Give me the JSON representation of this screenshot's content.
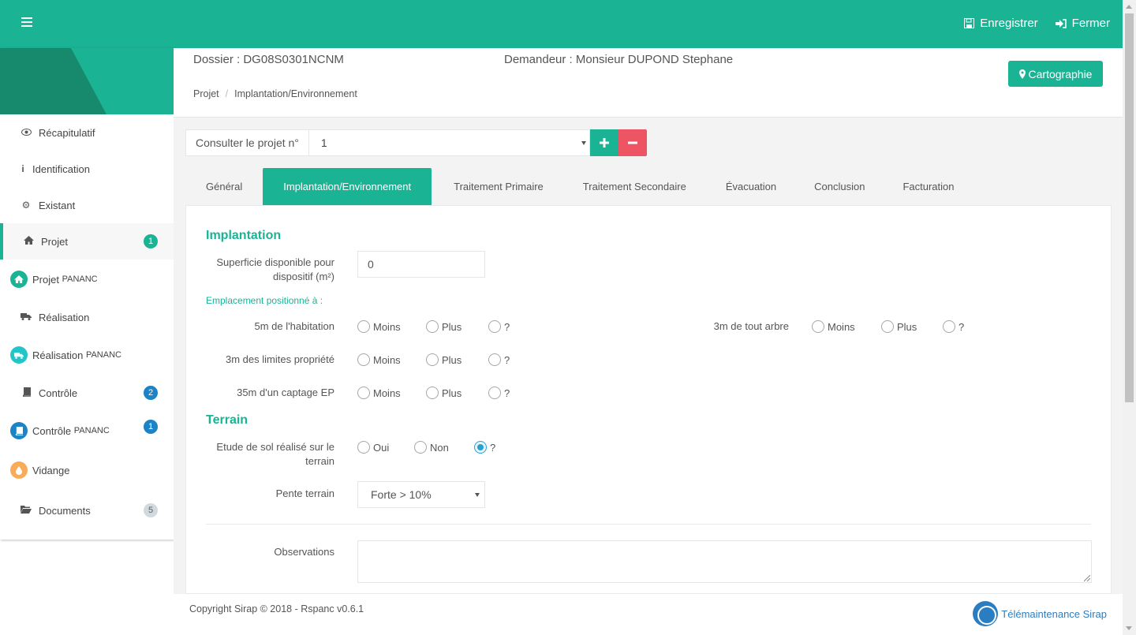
{
  "topbar": {
    "save_label": "Enregistrer",
    "close_label": "Fermer",
    "color": "#1ab394"
  },
  "sidebar": {
    "items": [
      {
        "label": "Récapitulatif",
        "icon": "eye-icon",
        "glyph": "👁"
      },
      {
        "label": "Identification",
        "icon": "info-icon",
        "glyph": "ℹ"
      },
      {
        "label": "Existant",
        "icon": "cogs-icon",
        "glyph": "⚙"
      },
      {
        "label": "Projet",
        "icon": "home-icon",
        "glyph": "⌂",
        "badge": "1",
        "active": true
      },
      {
        "label": "Projet",
        "label_small": "PANANC",
        "icon": "home-circle-icon"
      },
      {
        "label": "Réalisation",
        "icon": "truck-icon",
        "glyph": "🚚"
      },
      {
        "label": "Réalisation",
        "label_small": "PANANC",
        "icon": "truck-circle-icon"
      },
      {
        "label": "Contrôle",
        "icon": "book-icon",
        "glyph": "▤",
        "badge": "2"
      },
      {
        "label": "Contrôle",
        "label_small": "PANANC",
        "icon": "book-circle-icon",
        "badge": "1"
      },
      {
        "label": "Vidange",
        "icon": "drop-circle-icon"
      },
      {
        "label": "Documents",
        "icon": "folder-open-icon",
        "badge": "5"
      }
    ]
  },
  "header": {
    "dossier": "Dossier : DG08S0301NCNM",
    "demandeur": "Demandeur : Monsieur DUPOND  Stephane",
    "breadcrumb": [
      "Projet",
      "Implantation/Environnement"
    ],
    "carto_label": "Cartographie"
  },
  "project_select": {
    "label": "Consulter le projet n°",
    "value": "1"
  },
  "tabs": [
    "Général",
    "Implantation/Environnement",
    "Traitement Primaire",
    "Traitement Secondaire",
    "Évacuation",
    "Conclusion",
    "Facturation"
  ],
  "active_tab": "Implantation/Environnement",
  "form": {
    "implantation_title": "Implantation",
    "superficie_label": "Superficie disponible pour dispositif (m²)",
    "superficie_value": "0",
    "emplacement_label": "Emplacement positionné à :",
    "rows": [
      {
        "label": "5m de l'habitation",
        "options": [
          "Moins",
          "Plus",
          "?"
        ]
      },
      {
        "label": "3m de tout arbre",
        "options": [
          "Moins",
          "Plus",
          "?"
        ]
      },
      {
        "label": "3m des limites propriété",
        "options": [
          "Moins",
          "Plus",
          "?"
        ]
      },
      {
        "label": "35m d'un captage EP",
        "options": [
          "Moins",
          "Plus",
          "?"
        ]
      }
    ],
    "terrain_title": "Terrain",
    "etude_label": "Etude de sol réalisé sur le terrain",
    "etude_options": [
      "Oui",
      "Non",
      "?"
    ],
    "etude_selected": "?",
    "pente_label": "Pente terrain",
    "pente_value": "Forte > 10%",
    "observations_label": "Observations"
  },
  "footer": {
    "copyright": "Copyright Sirap © 2018 - Rspanc v0.6.1",
    "logo_text": "Télémaintenance Sirap"
  }
}
